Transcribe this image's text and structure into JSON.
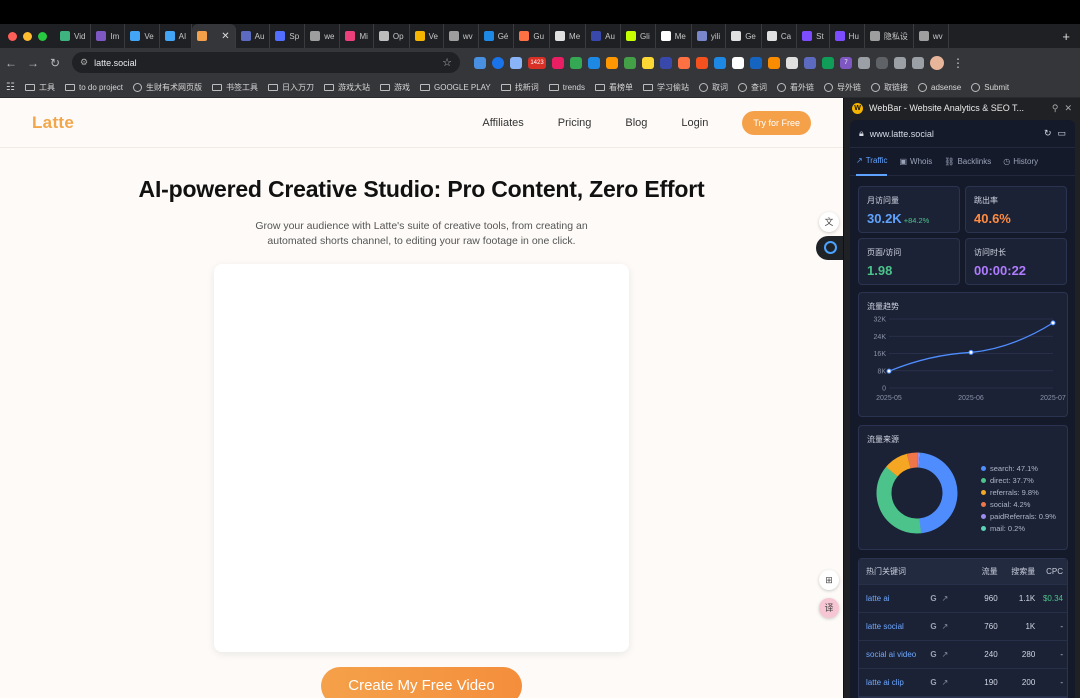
{
  "browser": {
    "tabs": [
      {
        "label": "Vid",
        "color": "#3fb37f"
      },
      {
        "label": "Im",
        "color": "#7e57c2"
      },
      {
        "label": "Ve",
        "color": "#42a5f5"
      },
      {
        "label": "AI",
        "color": "#42a5f5"
      },
      {
        "label": "",
        "color": "#f5a14a",
        "active": true
      },
      {
        "label": "Au",
        "color": "#5c6bc0"
      },
      {
        "label": "Sp",
        "color": "#536dfe"
      },
      {
        "label": "we",
        "color": "#9e9e9e"
      },
      {
        "label": "Mi",
        "color": "#ec407a"
      },
      {
        "label": "Op",
        "color": "#bdbdbd"
      },
      {
        "label": "Ve",
        "color": "#f5b400"
      },
      {
        "label": "wv",
        "color": "#9e9e9e"
      },
      {
        "label": "Gé",
        "color": "#1e88e5"
      },
      {
        "label": "Gu",
        "color": "#ff7043"
      },
      {
        "label": "Me",
        "color": "#e0e0e0"
      },
      {
        "label": "Au",
        "color": "#3949ab"
      },
      {
        "label": "Gli",
        "color": "#c6ff00"
      },
      {
        "label": "Me",
        "color": "#ffffff"
      },
      {
        "label": "yili",
        "color": "#7986cb"
      },
      {
        "label": "Ge",
        "color": "#e0e0e0"
      },
      {
        "label": "Ca",
        "color": "#e0e0e0"
      },
      {
        "label": "St",
        "color": "#7c4dff"
      },
      {
        "label": "Hu",
        "color": "#7c4dff"
      },
      {
        "label": "隐私设",
        "color": "#9e9e9e"
      },
      {
        "label": "wv",
        "color": "#9e9e9e"
      }
    ],
    "url": "latte.social",
    "ext_badge": "1423",
    "ext_badge2": "7",
    "bookmarks": [
      {
        "label": "工具",
        "type": "folder"
      },
      {
        "label": "to do project",
        "type": "folder"
      },
      {
        "label": "生财有术网页版",
        "type": "globe"
      },
      {
        "label": "书签工具",
        "type": "folder"
      },
      {
        "label": "日入万刀",
        "type": "folder"
      },
      {
        "label": "游戏大站",
        "type": "folder"
      },
      {
        "label": "游戏",
        "type": "folder"
      },
      {
        "label": "GOOGLE PLAY",
        "type": "folder"
      },
      {
        "label": "找新词",
        "type": "folder"
      },
      {
        "label": "trends",
        "type": "folder"
      },
      {
        "label": "看榜单",
        "type": "folder"
      },
      {
        "label": "学习偷站",
        "type": "folder"
      },
      {
        "label": "取词",
        "type": "globe"
      },
      {
        "label": "查词",
        "type": "globe"
      },
      {
        "label": "看外链",
        "type": "globe"
      },
      {
        "label": "导外链",
        "type": "globe"
      },
      {
        "label": "取链接",
        "type": "globe"
      },
      {
        "label": "adsense",
        "type": "globe"
      },
      {
        "label": "Submit",
        "type": "globe"
      }
    ]
  },
  "site": {
    "logo": "Latte",
    "nav": [
      "Affiliates",
      "Pricing",
      "Blog",
      "Login"
    ],
    "nav_cta": "Try for Free",
    "hero_title": "AI-powered Creative Studio: Pro Content, Zero Effort",
    "hero_sub": "Grow your audience with Latte's suite of creative tools, from creating an automated shorts channel, to editing your raw footage in one click.",
    "main_cta": "Create My Free Video"
  },
  "panel": {
    "title": "WebBar - Website Analytics & SEO T...",
    "logo_letter": "W",
    "domain": "www.latte.social",
    "tabs": [
      "Traffic",
      "Whois",
      "Backlinks",
      "History"
    ],
    "stats": [
      {
        "label": "月访问量",
        "value": "30.2K",
        "delta": "+84.2%",
        "color": "#5fa3ff"
      },
      {
        "label": "跳出率",
        "value": "40.6%",
        "delta": "",
        "color": "#ff8c42"
      },
      {
        "label": "页面/访问",
        "value": "1.98",
        "delta": "",
        "color": "#4cc38a"
      },
      {
        "label": "访问时长",
        "value": "00:00:22",
        "delta": "",
        "color": "#b07cff"
      }
    ],
    "trend_title": "流量趋势",
    "sources_title": "流量来源",
    "keywords_title": "热门关键词",
    "kw_headers": [
      "流量",
      "搜索量",
      "CPC"
    ],
    "keywords": [
      {
        "kw": "latte ai",
        "traffic": "960",
        "volume": "1.1K",
        "cpc": "$0.34"
      },
      {
        "kw": "latte social",
        "traffic": "760",
        "volume": "1K",
        "cpc": "-"
      },
      {
        "kw": "social ai video",
        "traffic": "240",
        "volume": "280",
        "cpc": "-"
      },
      {
        "kw": "latte ai clip",
        "traffic": "190",
        "volume": "200",
        "cpc": "-"
      }
    ]
  },
  "chart_data": [
    {
      "type": "line",
      "title": "流量趋势",
      "categories": [
        "2025-05",
        "2025-06",
        "2025-07"
      ],
      "values": [
        7800,
        16500,
        30200
      ],
      "ylim": [
        0,
        32000
      ],
      "yticks": [
        "0",
        "8K",
        "16K",
        "24K",
        "32K"
      ],
      "grid": true,
      "color": "#4f8dff"
    },
    {
      "type": "pie",
      "title": "流量来源",
      "series": [
        {
          "name": "search: 47.1%",
          "value": 47.1,
          "color": "#4f8dff"
        },
        {
          "name": "direct: 37.7%",
          "value": 37.7,
          "color": "#4cc38a"
        },
        {
          "name": "referrals: 9.8%",
          "value": 9.8,
          "color": "#f5a623"
        },
        {
          "name": "social: 4.2%",
          "value": 4.2,
          "color": "#f0764a"
        },
        {
          "name": "paidReferrals: 0.9%",
          "value": 0.9,
          "color": "#9b8cf0"
        },
        {
          "name": "mail: 0.2%",
          "value": 0.2,
          "color": "#5bd1b5"
        }
      ],
      "legend": "right"
    }
  ]
}
